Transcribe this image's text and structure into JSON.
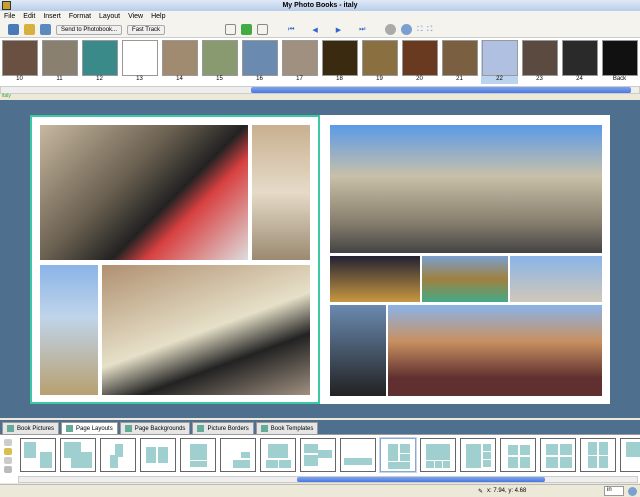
{
  "title": "My Photo Books  -  italy",
  "menu": [
    "File",
    "Edit",
    "Insert",
    "Format",
    "Layout",
    "View",
    "Help"
  ],
  "toolbar": {
    "send": "Send to Photobook...",
    "fast": "Fast Track"
  },
  "thumbnails": [
    "10",
    "11",
    "12",
    "13",
    "14",
    "15",
    "16",
    "17",
    "18",
    "19",
    "20",
    "21",
    "22",
    "23",
    "24",
    "Back"
  ],
  "selected_thumbnail": "22",
  "book_label": "italy",
  "tabs": [
    "Book Pictures",
    "Page Layouts",
    "Page Backgrounds",
    "Picture Borders",
    "Book Templates"
  ],
  "active_tab": "Page Layouts",
  "status": {
    "coords": "x: 7.94, y: 4.68",
    "unit": "in"
  },
  "colors": {
    "canvas": "#4e6f8e",
    "selection": "#3cc8a0",
    "layout_box": "#9fcfcf"
  }
}
